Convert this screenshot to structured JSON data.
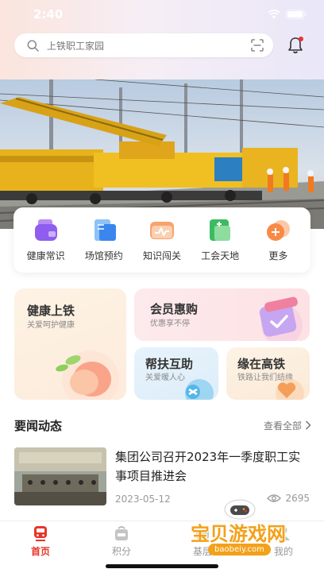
{
  "status_bar": {
    "time": "2:40"
  },
  "search": {
    "placeholder": "上铁职工家园"
  },
  "quick_links": [
    {
      "label": "健康常识",
      "icon": "health-knowledge-icon"
    },
    {
      "label": "场馆预约",
      "icon": "venue-booking-icon"
    },
    {
      "label": "知识闯关",
      "icon": "knowledge-quiz-icon"
    },
    {
      "label": "工会天地",
      "icon": "union-world-icon"
    },
    {
      "label": "更多",
      "icon": "more-icon"
    }
  ],
  "tiles": {
    "health": {
      "title": "健康上铁",
      "subtitle": "关爱呵护健康"
    },
    "member": {
      "title": "会员惠购",
      "subtitle": "优惠享不停"
    },
    "help": {
      "title": "帮扶互助",
      "subtitle": "关爱暖人心"
    },
    "romance": {
      "title": "缘在高铁",
      "subtitle": "铁路让我们结缘"
    }
  },
  "news": {
    "section_title": "要闻动态",
    "more_label": "查看全部",
    "items": [
      {
        "headline": "集团公司召开2023年一季度职工实事项目推进会",
        "date": "2023-05-12",
        "views": "2695"
      }
    ]
  },
  "tabbar": [
    {
      "label": "首页",
      "icon": "home-train-icon",
      "active": true
    },
    {
      "label": "积分",
      "icon": "points-bag-icon",
      "active": false
    },
    {
      "label": "基层",
      "icon": "grassroots-icon",
      "active": false
    },
    {
      "label": "我的",
      "icon": "profile-icon",
      "active": false
    }
  ],
  "watermark": {
    "text": "宝贝游戏网",
    "url": "baobeiy.com"
  },
  "colors": {
    "accent": "#e8352b",
    "tab_inactive": "#999999",
    "watermark": "#f3a11a"
  }
}
